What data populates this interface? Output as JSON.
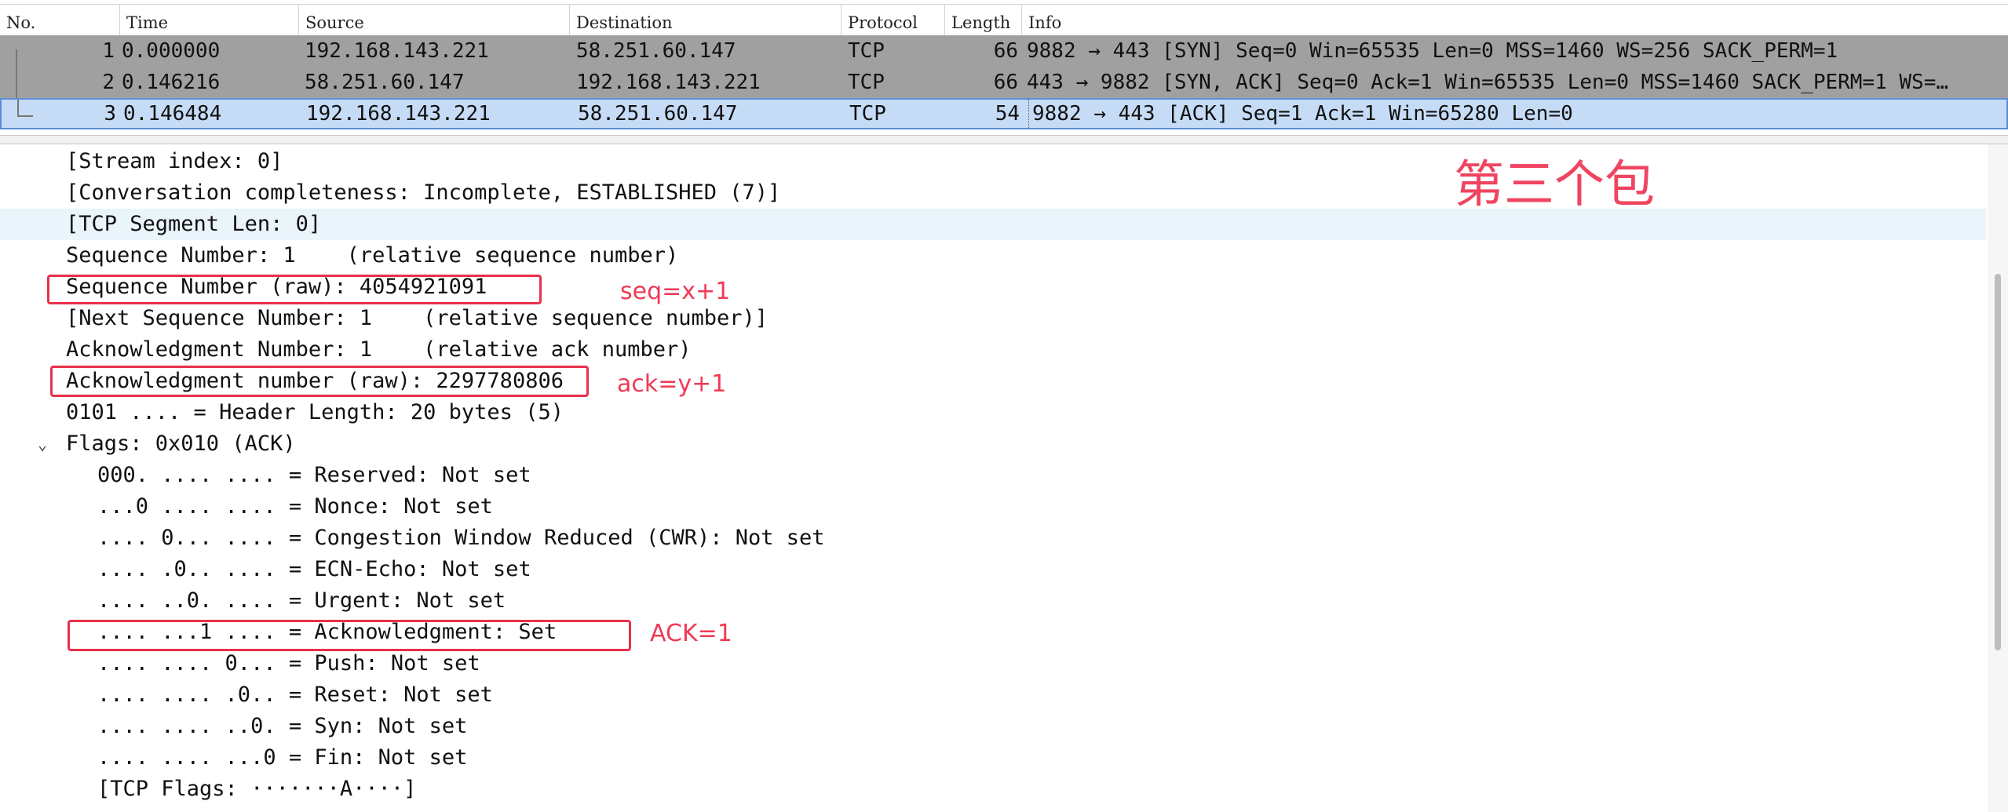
{
  "packet_list": {
    "columns": [
      "No.",
      "Time",
      "Source",
      "Destination",
      "Protocol",
      "Length",
      "Info"
    ],
    "rows": [
      {
        "no": "1",
        "time": "0.000000",
        "source": "192.168.143.221",
        "destination": "58.251.60.147",
        "protocol": "TCP",
        "length": "66",
        "info": "9882 → 443 [SYN] Seq=0 Win=65535 Len=0 MSS=1460 WS=256 SACK_PERM=1"
      },
      {
        "no": "2",
        "time": "0.146216",
        "source": "58.251.60.147",
        "destination": "192.168.143.221",
        "protocol": "TCP",
        "length": "66",
        "info": "443 → 9882 [SYN, ACK] Seq=0 Ack=1 Win=65535 Len=0 MSS=1460 SACK_PERM=1 WS=…"
      },
      {
        "no": "3",
        "time": "0.146484",
        "source": "192.168.143.221",
        "destination": "58.251.60.147",
        "protocol": "TCP",
        "length": "54",
        "info": "9882 → 443 [ACK] Seq=1 Ack=1 Win=65280 Len=0"
      }
    ],
    "colors": {
      "row_gray": "#a0a0a0",
      "row_selected": "#c6dcf6"
    }
  },
  "detail": {
    "lines": [
      "[Stream index: 0]",
      "[Conversation completeness: Incomplete, ESTABLISHED (7)]",
      "[TCP Segment Len: 0]",
      "Sequence Number: 1    (relative sequence number)",
      "Sequence Number (raw): 4054921091",
      "[Next Sequence Number: 1    (relative sequence number)]",
      "Acknowledgment Number: 1    (relative ack number)",
      "Acknowledgment number (raw): 2297780806",
      "0101 .... = Header Length: 20 bytes (5)",
      "Flags: 0x010 (ACK)",
      "000. .... .... = Reserved: Not set",
      "...0 .... .... = Nonce: Not set",
      ".... 0... .... = Congestion Window Reduced (CWR): Not set",
      ".... .0.. .... = ECN-Echo: Not set",
      ".... ..0. .... = Urgent: Not set",
      ".... ...1 .... = Acknowledgment: Set",
      ".... .... 0... = Push: Not set",
      ".... .... .0.. = Reset: Not set",
      ".... .... ..0. = Syn: Not set",
      ".... .... ...0 = Fin: Not set",
      "[TCP Flags: ·······A····]"
    ],
    "flags_expander": "⌄"
  },
  "annotations": {
    "title": "第三个包",
    "seq": "seq=x+1",
    "ack_num": "ack=y+1",
    "ack_flag": "ACK=1",
    "color": "#e8314a"
  }
}
